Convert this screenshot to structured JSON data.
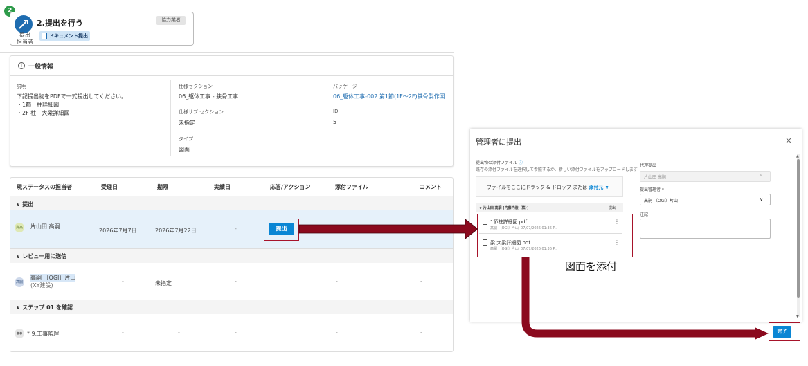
{
  "step": {
    "number": "2",
    "title": "2.提出を行う",
    "role_chip": "協力業者",
    "assignee_label_1": "提出",
    "assignee_label_2": "担当者",
    "doc_chip": "ドキュメント提出"
  },
  "general": {
    "heading": "一般情報",
    "desc_label": "説明",
    "desc_lines": [
      "下記提出物をPDFで一式提出してください。",
      "・1節　柱詳細図",
      "・2F 柱　大梁詳細図"
    ],
    "spec_label": "仕様セクション",
    "spec_value": "06_躯体工事 - 鉄骨工事",
    "subspec_label": "仕様サブ セクション",
    "subspec_value": "未指定",
    "type_label": "タイプ",
    "type_value": "図面",
    "package_label": "パッケージ",
    "package_value": "06_躯体工事-002 第1節(1F〜2F)鉄骨製作図",
    "id_label": "ID",
    "id_value": "5"
  },
  "table": {
    "headers": [
      "現ステータスの担当者",
      "受理日",
      "期限",
      "実績日",
      "応答/アクション",
      "添付ファイル",
      "コメント"
    ],
    "group1": "提出",
    "group2": "レビュー用に送信",
    "group3": "ステップ 01 を確認",
    "row1": {
      "avatar": "片高",
      "name": "片山田 高嗣",
      "received": "2026年7月7日",
      "due": "2026年7月22日",
      "actual": "-",
      "action": "提出"
    },
    "row2": {
      "avatar": "高嗣",
      "name": "高嗣 〔OGI〕片山",
      "company": "(XY建設)",
      "received": "-",
      "due": "未指定",
      "actual": "-",
      "attach": "-",
      "comment": "-"
    },
    "row3": {
      "name": "* 9.工事監理",
      "received": "-",
      "due": "-",
      "actual": "-",
      "attach": "-",
      "comment": "-"
    }
  },
  "modal": {
    "title": "管理者に提出",
    "close": "×",
    "attach_label": "提出物の添付ファイル",
    "attach_help": "既存の添付ファイルを選択して参照するか、新しい添付ファイルをアップロードします",
    "drop_text": "ファイルをここにドラッグ & ドロップ または",
    "drop_link": "添付元",
    "list_header": "片山田 高嗣 (内藤内装（株）)",
    "list_header_right": "提出",
    "files": [
      {
        "name": "1節柱詳細図.pdf",
        "meta": "高嗣 〔OGI〕片山, 07/07/2026 01:36 P..."
      },
      {
        "name": "梁 大梁詳細図.pdf",
        "meta": "高嗣 〔OGI〕片山, 07/07/2026 01:36 P..."
      }
    ],
    "proxy_label": "代理提出",
    "proxy_value": "片山田 高嗣",
    "manager_label": "提出管理者 *",
    "manager_value": "高嗣 〔OGI〕片山",
    "note_label": "注記",
    "done_button": "完了"
  },
  "annotation": "図面を添付",
  "colors": {
    "accent": "#0a86d4",
    "arrow": "#8b0a1e",
    "success": "#2e9b4a"
  }
}
